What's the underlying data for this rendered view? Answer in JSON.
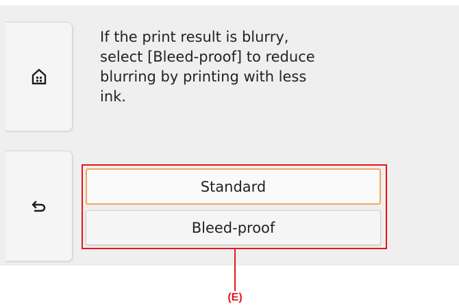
{
  "message": "If the print result is blurry,\nselect [Bleed-proof] to reduce\nblurring by printing with less\nink.",
  "side_buttons": {
    "home_icon": "home-icon",
    "back_icon": "back-arrow-icon"
  },
  "options": [
    {
      "label": "Standard",
      "focused": true
    },
    {
      "label": "Bleed-proof",
      "focused": false
    }
  ],
  "callout": {
    "label": "(E)",
    "color": "#e8141a"
  },
  "colors": {
    "screen_background": "#efefef",
    "focus_border": "#f5a45d",
    "highlight_frame": "#e8141a"
  }
}
